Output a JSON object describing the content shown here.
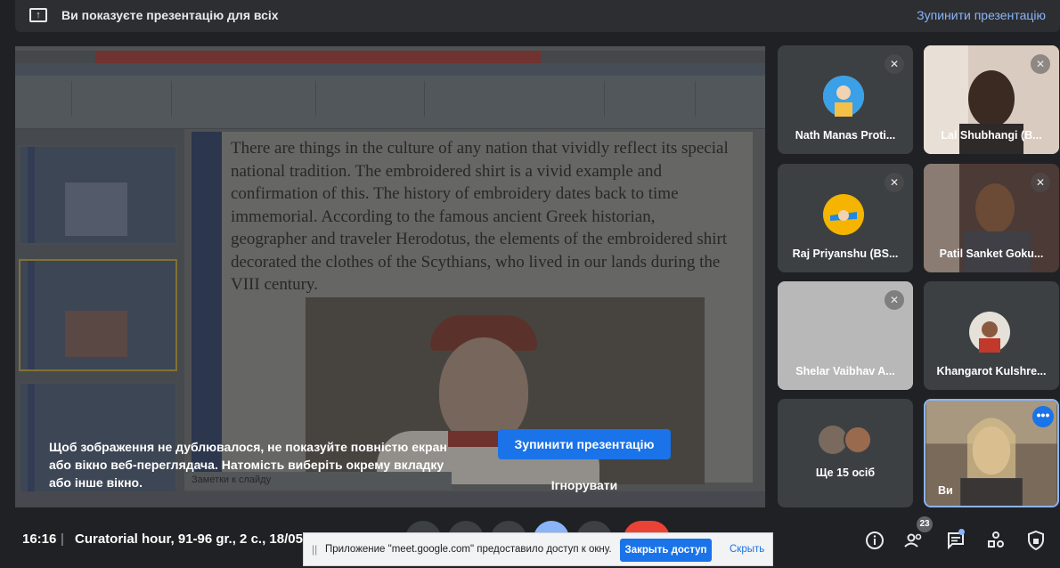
{
  "banner": {
    "title": "Ви показуєте презентацію для всіх",
    "stop_link": "Зупинити презентацію"
  },
  "slide": {
    "body_text": "There are things in the culture of any nation that vividly reflect its special national tradition. The embroidered shirt is a vivid example and confirmation of this. The history of embroidery dates back to time immemorial. According to the famous ancient Greek historian, geographer and traveler Herodotus, the elements of the embroidered shirt decorated the clothes of the Scythians, who lived in our lands during the VIII century.",
    "notes_placeholder": "Заметки к слайду"
  },
  "warning": {
    "text": "Щоб зображення не дублювалося, не показуйте повністю екран або вікно веб-переглядача. Натомість виберіть окрему вкладку або інше вікно.",
    "stop_button": "Зупинити презентацію",
    "ignore_button": "Ігнорувати"
  },
  "participants": [
    {
      "name": "Nath Manas Proti...",
      "muted": true
    },
    {
      "name": "Lal Shubhangi (B...",
      "muted": true
    },
    {
      "name": "Raj Priyanshu (BS...",
      "muted": true
    },
    {
      "name": "Patil Sanket Goku...",
      "muted": true
    },
    {
      "name": "Shelar Vaibhav A...",
      "muted": true
    },
    {
      "name": "Khangarot Kulshre...",
      "muted": false
    },
    {
      "name": "Ще 15 осіб",
      "muted": false
    },
    {
      "name": "Ви",
      "muted": false
    }
  ],
  "meeting": {
    "time": "16:16",
    "separator": "|",
    "title": "Curatorial hour, 91-96 gr., 2 c., 18/05/"
  },
  "share_notice": {
    "text": "Приложение \"meet.google.com\" предоставило доступ к окну.",
    "close_button": "Закрыть доступ",
    "hide_link": "Скрыть"
  },
  "people_count": "23",
  "colors": {
    "accent_blue": "#1a73e8",
    "link_blue": "#8ab4f8",
    "background": "#202124",
    "tile": "#3c4043"
  }
}
